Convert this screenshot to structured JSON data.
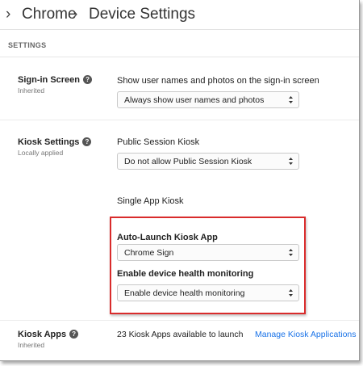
{
  "breadcrumb": {
    "items": [
      "Chrome",
      "Device Settings"
    ]
  },
  "section": {
    "title": "SETTINGS"
  },
  "settings": {
    "signin": {
      "label": "Sign-in Screen",
      "status": "Inherited",
      "field_label": "Show user names and photos on the sign-in screen",
      "selected": "Always show user names and photos"
    },
    "kiosk": {
      "label": "Kiosk Settings",
      "status": "Locally applied",
      "public_label": "Public Session Kiosk",
      "public_selected": "Do not allow Public Session Kiosk",
      "single_app_label": "Single App Kiosk",
      "auto_launch_label": "Auto-Launch Kiosk App",
      "auto_launch_selected": "Chrome Sign",
      "health_label": "Enable device health monitoring",
      "health_selected": "Enable device health monitoring"
    },
    "kiosk_apps": {
      "label": "Kiosk Apps",
      "status": "Inherited",
      "count_text": "23 Kiosk Apps available to launch",
      "manage_link": "Manage Kiosk Applications"
    }
  },
  "colors": {
    "highlight": "#d92b2b",
    "link": "#1a73e8"
  },
  "icons": {
    "help": "help-circle-icon",
    "chevron": "chevron-right-icon",
    "select_arrows": "updown-arrows-icon"
  }
}
